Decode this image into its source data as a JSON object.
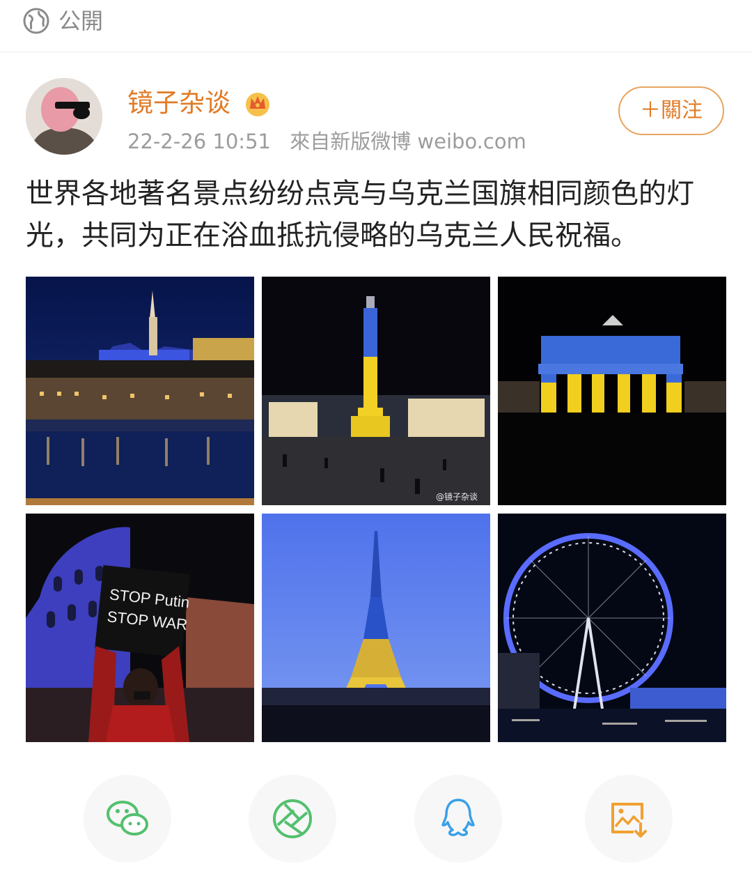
{
  "visibility": {
    "label": "公開",
    "icon": "globe-icon"
  },
  "post": {
    "author": {
      "name": "镜子杂谈",
      "badge_icon": "crown-icon",
      "avatar_icon": "avatar"
    },
    "time": "22-2-26 10:51",
    "source": "來自新版微博 weibo.com",
    "follow_label": "＋關注",
    "text": "世界各地著名景点纷纷点亮与乌克兰国旗相同颜色的灯光，共同为正在浴血抵抗侵略的乌克兰人民祝福。",
    "images": [
      {
        "subject": "budapest-castle-photo"
      },
      {
        "subject": "nelson-column-photo",
        "watermark": "@镜子杂谈"
      },
      {
        "subject": "brandenburg-gate-photo"
      },
      {
        "subject": "colosseum-protest-photo",
        "sign_line1": "STOP Putin",
        "sign_line2": "STOP WAR"
      },
      {
        "subject": "eiffel-tower-photo"
      },
      {
        "subject": "london-eye-photo"
      }
    ]
  },
  "share": [
    {
      "icon": "wechat-icon",
      "color": "#53c06e"
    },
    {
      "icon": "moments-icon",
      "color": "#53c06e"
    },
    {
      "icon": "qq-icon",
      "color": "#3aa0e8"
    },
    {
      "icon": "save-image-icon",
      "color": "#f0a030"
    }
  ],
  "colors": {
    "accent": "#e07b26",
    "ukraine_blue": "#2a5bd7",
    "ukraine_yellow": "#f5d020"
  }
}
